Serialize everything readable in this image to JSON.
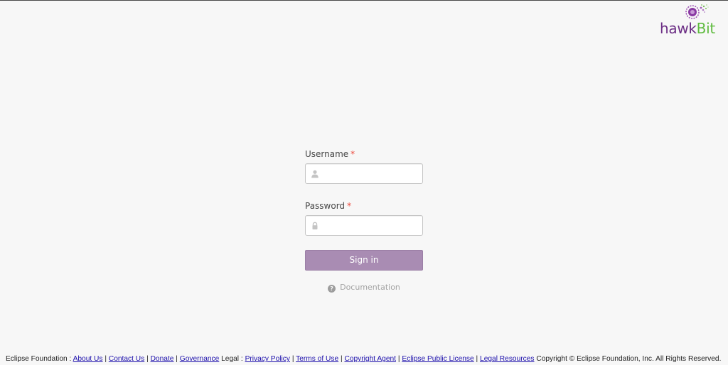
{
  "logo": {
    "text_hawk": "hawk",
    "text_bit": "Bit",
    "colors": {
      "hawk": "#6b2d84",
      "bit": "#5fbb3f"
    }
  },
  "login": {
    "username": {
      "label": "Username",
      "required_mark": "*",
      "value": "",
      "placeholder": "",
      "icon": "user-icon"
    },
    "password": {
      "label": "Password",
      "required_mark": "*",
      "value": "",
      "placeholder": "",
      "icon": "lock-icon"
    },
    "signin_label": "Sign in",
    "documentation": {
      "label": "Documentation",
      "icon": "question-circle-icon"
    }
  },
  "footer": {
    "prefix": "Eclipse Foundation :",
    "links": {
      "about": "About Us",
      "contact": "Contact Us",
      "donate": "Donate",
      "governance": "Governance",
      "privacy": "Privacy Policy",
      "terms": "Terms of Use",
      "copyright_agent": "Copyright Agent",
      "license": "Eclipse Public License",
      "legal_resources": "Legal Resources"
    },
    "legal_label": "Legal :",
    "separator": "|",
    "copyright": "Copyright © Eclipse Foundation, Inc. All Rights Reserved."
  },
  "colors": {
    "accent": "#a98cb3",
    "required": "#ed473b",
    "background": "#f7f7f7",
    "link": "#1a0dab"
  }
}
